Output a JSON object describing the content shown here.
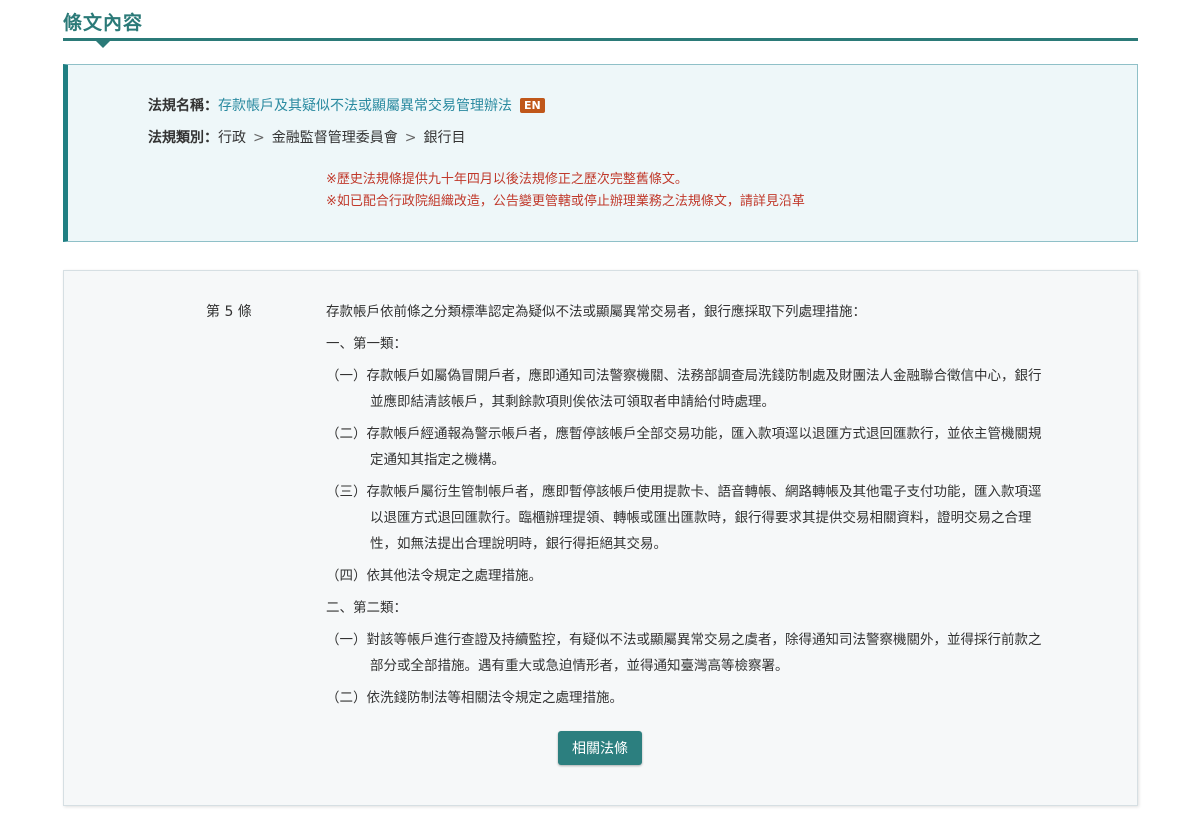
{
  "section": {
    "title": "條文內容"
  },
  "info": {
    "name_label": "法規名稱：",
    "name_value": "存款帳戶及其疑似不法或顯屬異常交易管理辦法",
    "en_badge": "EN",
    "category_label": "法規類別：",
    "category_path": [
      "行政",
      "金融監督管理委員會",
      "銀行目"
    ],
    "separator": ">",
    "notes": [
      "※歷史法規條提供九十年四月以後法規修正之歷次完整舊條文。",
      "※如已配合行政院組織改造，公告變更管轄或停止辦理業務之法規條文，請詳見沿革"
    ]
  },
  "article": {
    "number": "第 5 條",
    "intro": "存款帳戶依前條之分類標準認定為疑似不法或顯屬異常交易者，銀行應採取下列處理措施：",
    "sections": [
      {
        "heading": "一、第一類：",
        "items": [
          "（一）存款帳戶如屬偽冒開戶者，應即通知司法警察機關、法務部調查局洗錢防制處及財團法人金融聯合徵信中心，銀行並應即結清該帳戶，其剩餘款項則俟依法可領取者申請給付時處理。",
          "（二）存款帳戶經通報為警示帳戶者，應暫停該帳戶全部交易功能，匯入款項逕以退匯方式退回匯款行，並依主管機關規定通知其指定之機構。",
          "（三）存款帳戶屬衍生管制帳戶者，應即暫停該帳戶使用提款卡、語音轉帳、網路轉帳及其他電子支付功能，匯入款項逕以退匯方式退回匯款行。臨櫃辦理提領、轉帳或匯出匯款時，銀行得要求其提供交易相關資料，證明交易之合理性，如無法提出合理說明時，銀行得拒絕其交易。",
          "（四）依其他法令規定之處理措施。"
        ]
      },
      {
        "heading": "二、第二類：",
        "items": [
          "（一）對該等帳戶進行查證及持續監控，有疑似不法或顯屬異常交易之虞者，除得通知司法警察機關外，並得採行前款之部分或全部措施。遇有重大或急迫情形者，並得通知臺灣高等檢察署。",
          "（二）依洗錢防制法等相關法令規定之處理措施。"
        ]
      }
    ],
    "related_button": "相關法條"
  },
  "colors": {
    "accent": "#2b7a78",
    "link": "#2a8aa0",
    "note_red": "#c0392b",
    "badge": "#c0571a",
    "info_bg": "#eef7f9",
    "article_bg": "#f6f8f9"
  }
}
